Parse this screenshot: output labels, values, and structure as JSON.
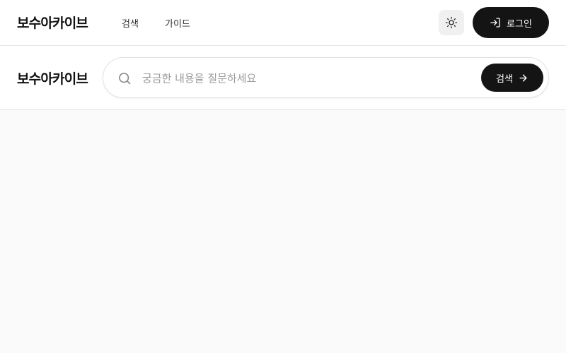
{
  "header": {
    "brand": "보수아카이브",
    "nav": [
      {
        "label": "검색"
      },
      {
        "label": "가이드"
      }
    ],
    "theme_toggle_icon": "sun-icon",
    "login": {
      "label": "로그인",
      "icon": "login-icon"
    }
  },
  "search_band": {
    "brand": "보수아카이브",
    "search": {
      "placeholder": "궁금한 내용을 질문하세요",
      "value": "",
      "submit_label": "검색",
      "submit_icon": "arrow-right-icon"
    }
  },
  "colors": {
    "primary": "#141414",
    "background": "#fafafa",
    "surface": "#ffffff",
    "border": "#e6e6e6",
    "placeholder": "#9a9a9a"
  }
}
